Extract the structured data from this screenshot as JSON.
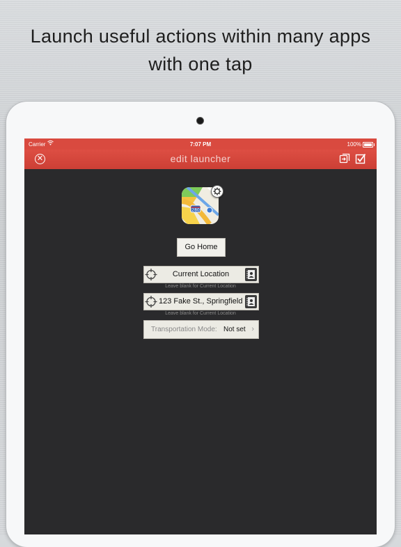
{
  "headline": {
    "line1": "Launch useful actions within many apps",
    "line2": "with one tap"
  },
  "status_bar": {
    "carrier": "Carrier",
    "time": "7:07 PM",
    "battery": "100%"
  },
  "nav": {
    "title": "edit launcher",
    "close_icon": "close-icon",
    "share_icon": "duplicate-icon",
    "confirm_icon": "checkbox-icon"
  },
  "action": {
    "app_icon": "maps-app-icon",
    "button_label": "Go Home"
  },
  "fields": [
    {
      "value": "Current Location",
      "hint": "Leave blank for Current Location"
    },
    {
      "value": "123 Fake St., Springfield",
      "hint": "Leave blank for Current Location"
    }
  ],
  "transport": {
    "label": "Transportation Mode:",
    "value": "Not set"
  },
  "colors": {
    "nav_red": "#d94a3f",
    "screen_bg": "#2a2a2c",
    "field_bg": "#ecebe4"
  }
}
